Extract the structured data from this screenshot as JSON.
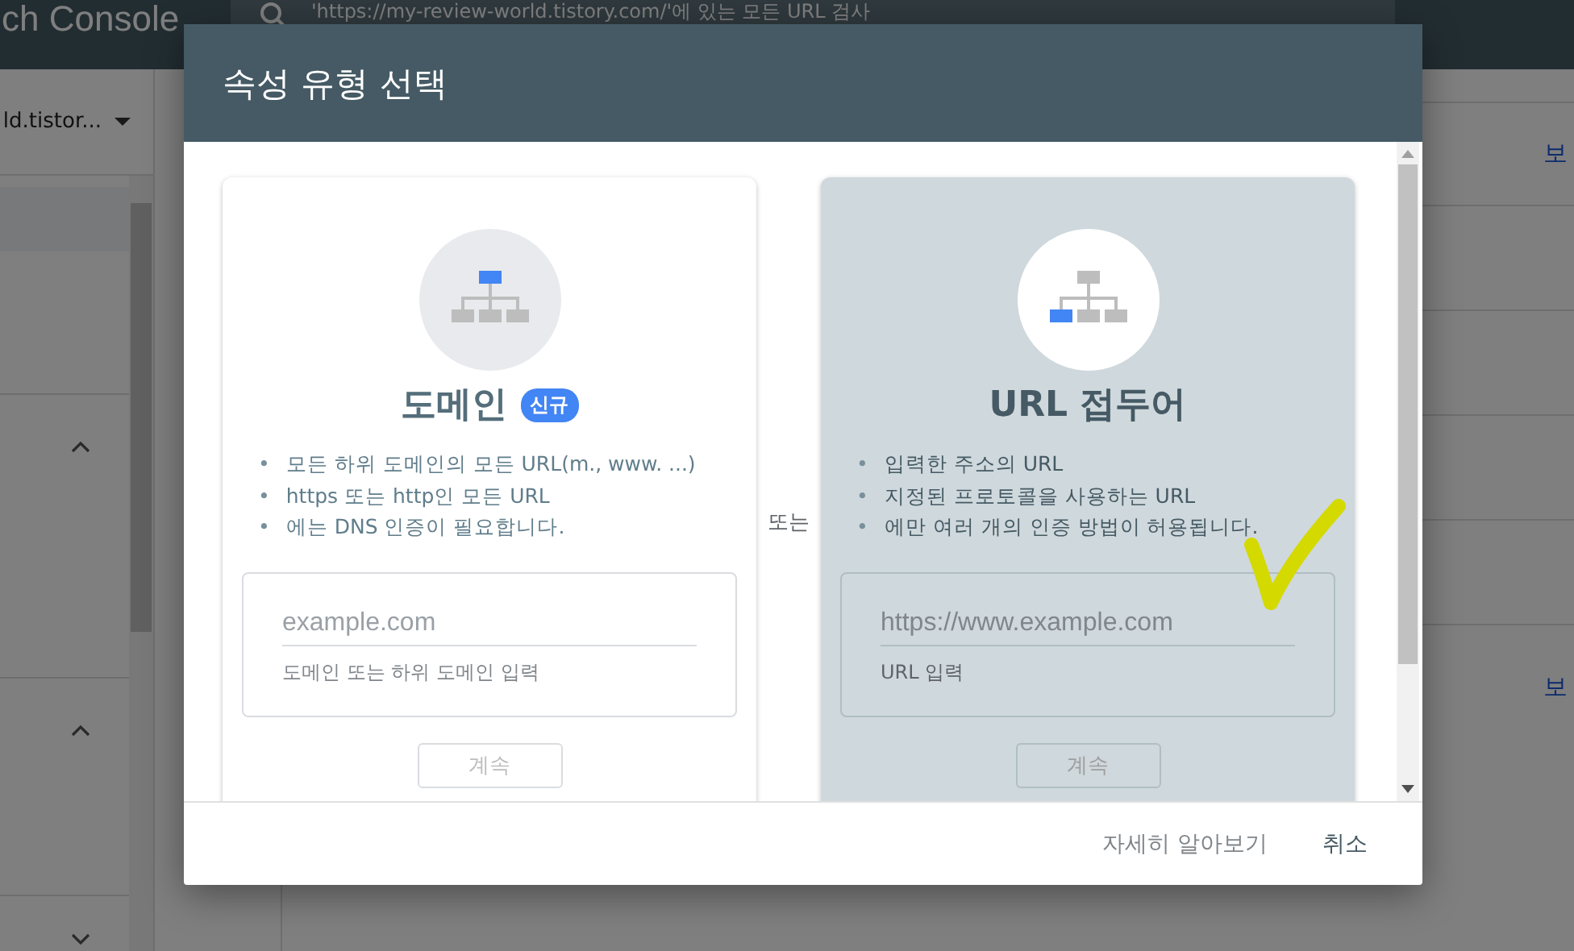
{
  "app_header": {
    "logo_text": "ch Console",
    "search_text": "'https://my-review-world.tistory.com/'에 있는 모든 URL 검사"
  },
  "property_selector": {
    "label": "ld.tistor..."
  },
  "sidebar": {
    "sections": [
      {
        "expanded": true
      },
      {
        "expanded": true
      },
      {
        "expanded": false
      }
    ]
  },
  "content": {
    "links": [
      "보",
      "보"
    ]
  },
  "dialog": {
    "title": "속성 유형 선택",
    "separator": "또는",
    "bullet_marker": "•",
    "options": [
      {
        "kind": "domain",
        "title": "도메인",
        "badge": "신규",
        "selected": false,
        "bullets": [
          "모든 하위 도메인의 모든 URL(m., www. ...)",
          "https 또는 http인 모든 URL",
          "에는 DNS 인증이 필요합니다."
        ],
        "input": {
          "placeholder": "example.com",
          "helper": "도메인 또는 하위 도메인 입력"
        },
        "button": "계속"
      },
      {
        "kind": "url_prefix",
        "title": "URL 접두어",
        "selected": true,
        "bullets": [
          "입력한 주소의 URL",
          "지정된 프로토콜을 사용하는 URL",
          "에만 여러 개의 인증 방법이 허용됩니다."
        ],
        "input": {
          "placeholder": "https://www.example.com",
          "helper": "URL 입력"
        },
        "button": "계속"
      }
    ],
    "footer_buttons": [
      {
        "label": "자세히 알아보기",
        "kind": "secondary"
      },
      {
        "label": "취소",
        "kind": "primary"
      }
    ]
  }
}
